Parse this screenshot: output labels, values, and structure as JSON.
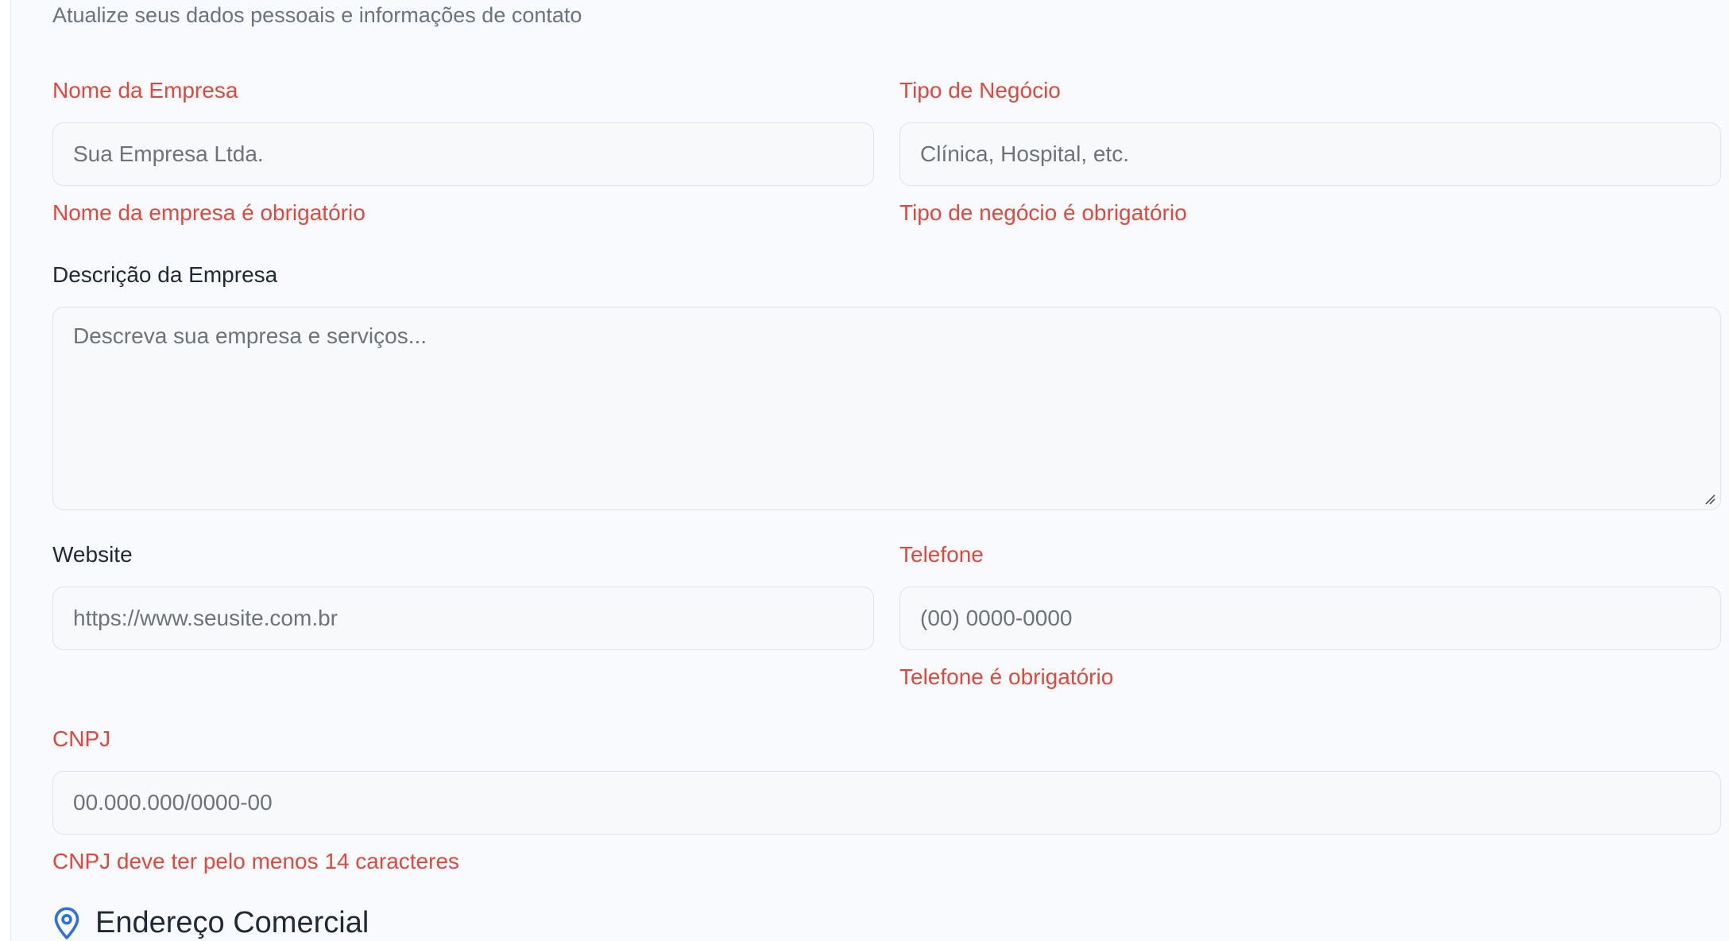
{
  "header": {
    "subtitle": "Atualize seus dados pessoais e informações de contato"
  },
  "form": {
    "company_name": {
      "label": "Nome da Empresa",
      "placeholder": "Sua Empresa Ltda.",
      "error": "Nome da empresa é obrigatório"
    },
    "business_type": {
      "label": "Tipo de Negócio",
      "placeholder": "Clínica, Hospital, etc.",
      "error": "Tipo de negócio é obrigatório"
    },
    "description": {
      "label": "Descrição da Empresa",
      "placeholder": "Descreva sua empresa e serviços..."
    },
    "website": {
      "label": "Website",
      "placeholder": "https://www.seusite.com.br"
    },
    "phone": {
      "label": "Telefone",
      "placeholder": "(00) 0000-0000",
      "error": "Telefone é obrigatório"
    },
    "cnpj": {
      "label": "CNPJ",
      "placeholder": "00.000.000/0000-00",
      "error": "CNPJ deve ter pelo menos 14 caracteres"
    }
  },
  "address_section": {
    "title": "Endereço Comercial",
    "icon": "map-pin-icon"
  },
  "colors": {
    "error": "#dc4a3f",
    "accent": "#2f6fe0",
    "text": "#1f2937",
    "muted": "#6b7280"
  }
}
